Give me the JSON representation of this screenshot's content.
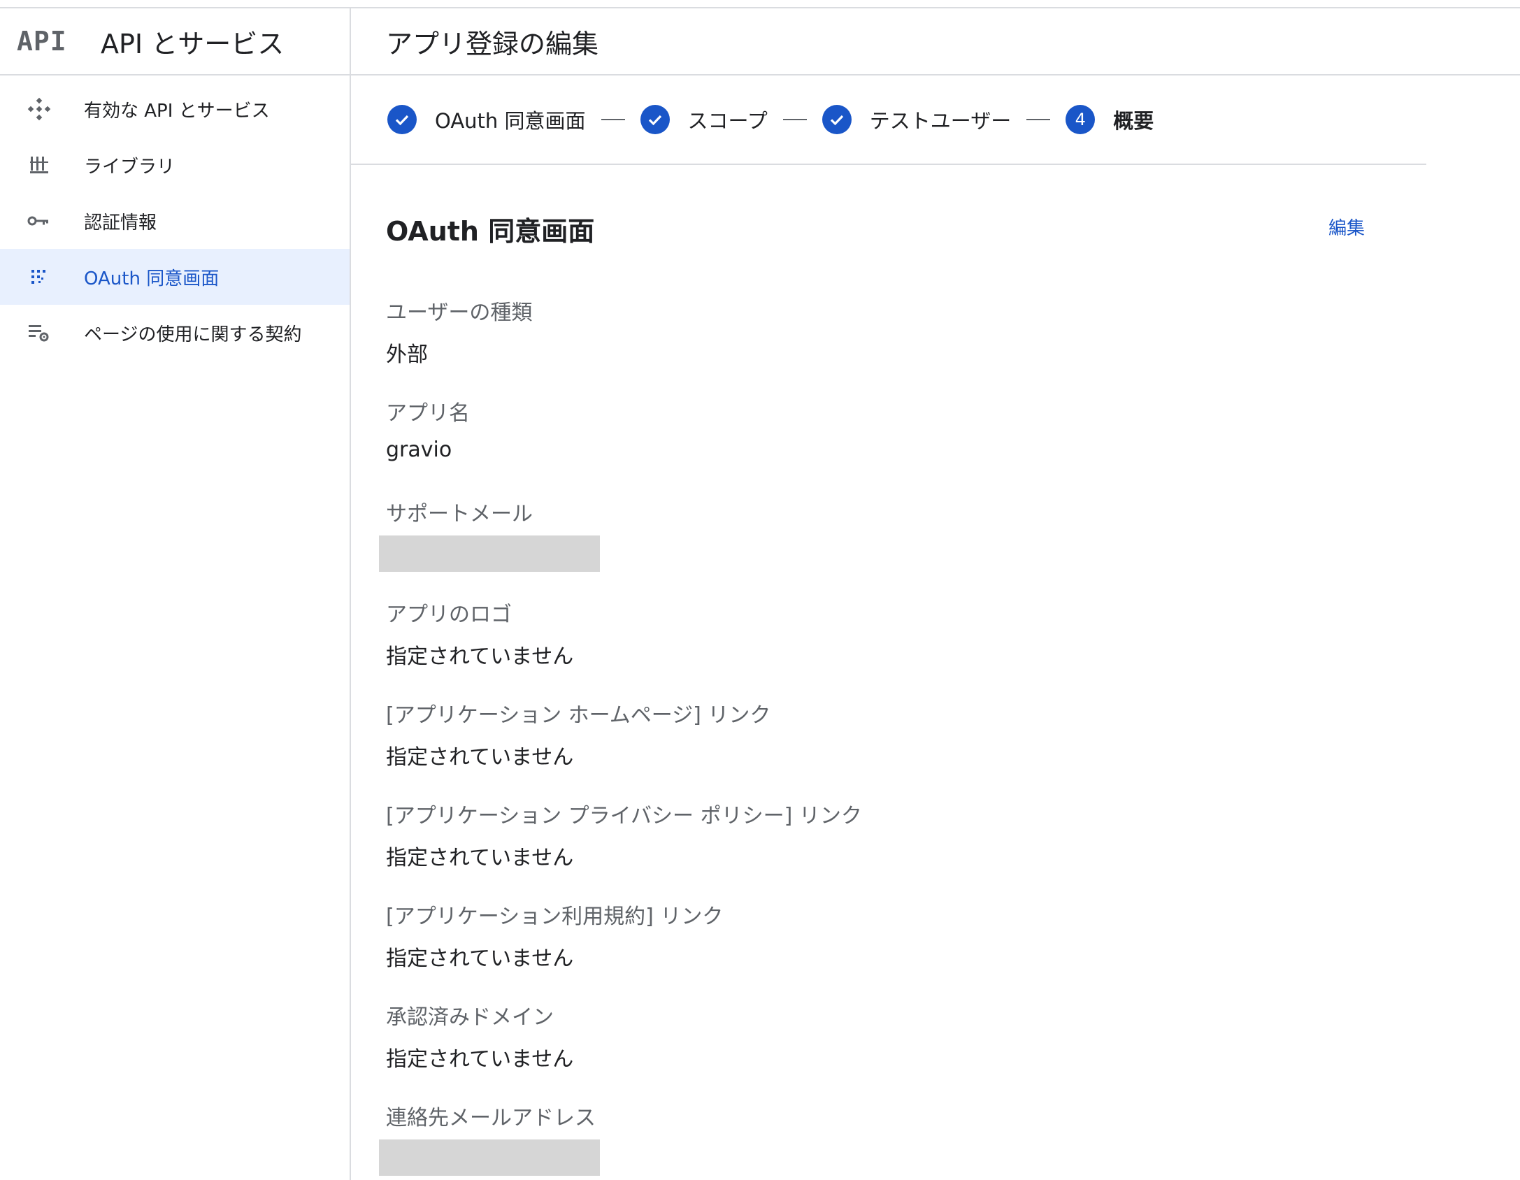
{
  "sidebar": {
    "logo_text": "API",
    "title": "API とサービス",
    "items": [
      {
        "label": "有効な API とサービス",
        "icon": "api-diamond-icon"
      },
      {
        "label": "ライブラリ",
        "icon": "library-icon"
      },
      {
        "label": "認証情報",
        "icon": "key-icon"
      },
      {
        "label": "OAuth 同意画面",
        "icon": "consent-dots-icon",
        "active": true
      },
      {
        "label": "ページの使用に関する契約",
        "icon": "settings-list-icon"
      }
    ]
  },
  "main": {
    "title": "アプリ登録の編集",
    "steps": [
      {
        "label": "OAuth 同意画面",
        "state": "done"
      },
      {
        "label": "スコープ",
        "state": "done"
      },
      {
        "label": "テストユーザー",
        "state": "done"
      },
      {
        "label": "概要",
        "number": "4",
        "state": "current"
      }
    ],
    "section": {
      "title": "OAuth 同意画面",
      "edit_label": "編集",
      "fields": [
        {
          "label": "ユーザーの種類",
          "value": "外部"
        },
        {
          "label": "アプリ名",
          "value": "gravio"
        },
        {
          "label": "サポートメール",
          "value": null
        },
        {
          "label": "アプリのロゴ",
          "value": "指定されていません"
        },
        {
          "label": "[アプリケーション ホームページ] リンク",
          "value": "指定されていません"
        },
        {
          "label": "[アプリケーション プライバシー ポリシー] リンク",
          "value": "指定されていません"
        },
        {
          "label": "[アプリケーション利用規約] リンク",
          "value": "指定されていません"
        },
        {
          "label": "承認済みドメイン",
          "value": "指定されていません"
        },
        {
          "label": "連絡先メールアドレス",
          "value": null
        }
      ]
    }
  },
  "colors": {
    "accent": "#1a56c8",
    "active_bg": "#e8f0fe",
    "divider": "#dadce0",
    "redacted": "#d6d6d6"
  }
}
